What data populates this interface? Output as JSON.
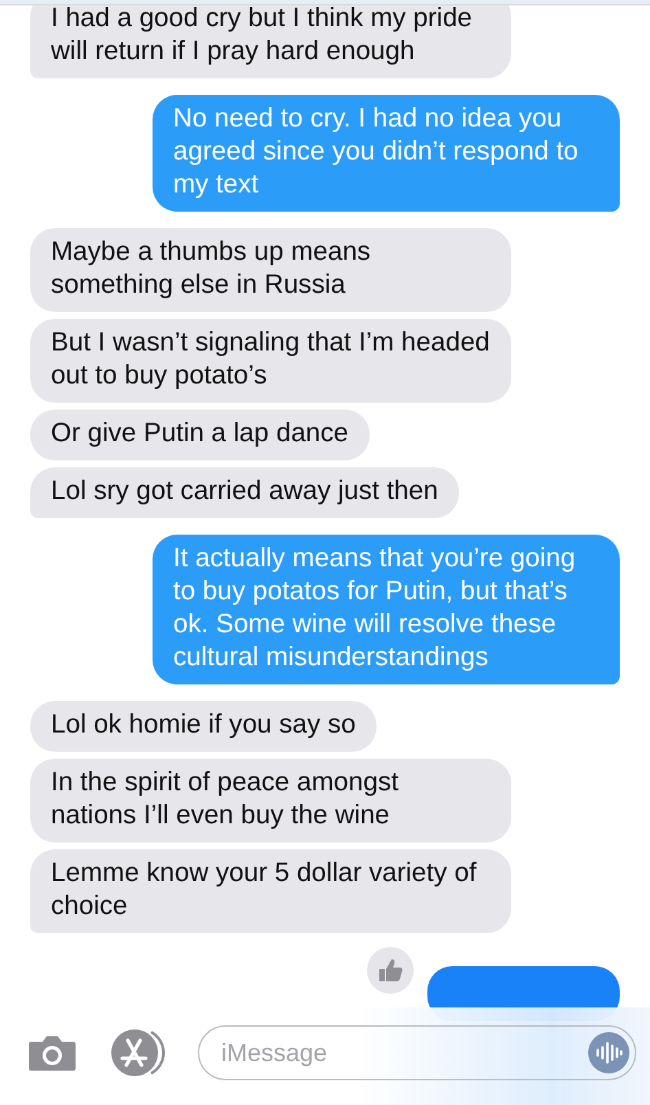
{
  "messages": [
    {
      "kind": "received",
      "text": "I had a good cry but I think my pride will return if I pray hard enough",
      "tail": true
    },
    {
      "kind": "sent",
      "text": "No need to cry. I had no idea you agreed since you didn’t respond to my text",
      "tail": true
    },
    {
      "kind": "received",
      "text": "Maybe a thumbs up means something else in Russia",
      "tail": false
    },
    {
      "kind": "received",
      "text": "But I wasn’t signaling that I’m headed out to buy potato’s",
      "tail": false
    },
    {
      "kind": "received",
      "text": "Or give Putin a lap dance",
      "tail": false
    },
    {
      "kind": "received",
      "text": "Lol sry got carried away just then",
      "tail": true
    },
    {
      "kind": "sent",
      "text": "It actually means that you’re going to buy potatos for Putin, but that’s ok. Some wine will resolve these cultural misunderstandings",
      "tail": true
    },
    {
      "kind": "received",
      "text": "Lol ok homie if you say so",
      "tail": false
    },
    {
      "kind": "received",
      "text": "In the spirit of peace amongst nations I’ll even buy the wine",
      "tail": false
    },
    {
      "kind": "received",
      "text": "Lemme know your 5 dollar variety of choice",
      "tail": true
    },
    {
      "kind": "sent-partial",
      "tapback": true
    }
  ],
  "composer": {
    "placeholder": "iMessage"
  }
}
